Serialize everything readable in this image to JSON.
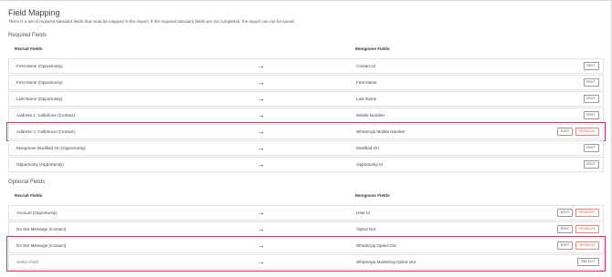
{
  "header": {
    "title": "Field Mapping",
    "description": "There is a set of required standard fields that must be mapped in the import. If the required standard fields are not completed, the import can not be saved."
  },
  "required": {
    "title": "Required Fields",
    "col_left": "Recruit Fields",
    "col_right": "Mongoose Fields",
    "rows": [
      {
        "left": "First Name (Opportunity)",
        "right": "Contact Id",
        "edit": "EDIT"
      },
      {
        "left": "First Name (Opportunity)",
        "right": "First Name",
        "edit": "EDIT"
      },
      {
        "left": "Last Name (Opportunity)",
        "right": "Last Name",
        "edit": "EDIT"
      },
      {
        "left": "Address 1: Cellphone (Contact)",
        "right": "Mobile Number",
        "edit": "EDIT"
      },
      {
        "left": "Address 1: Cellphone (Contact)",
        "right": "WhatsApp Mobile Number",
        "edit": "EDIT",
        "remove": "REMOVE"
      },
      {
        "left": "Mongoose Modified On (Opportunity)",
        "right": "Modified On",
        "edit": "EDIT"
      },
      {
        "left": "Opportunity (Opportunity)",
        "right": "Opportunity Id",
        "edit": "EDIT"
      }
    ]
  },
  "optional": {
    "title": "Optional Fields",
    "col_left": "Recruit Fields",
    "col_right": "Mongoose Fields",
    "rows": [
      {
        "left": "Account (Opportunity)",
        "right": "User Id",
        "edit": "EDIT",
        "remove": "REMOVE"
      },
      {
        "left": "Do Not Message (Contact)",
        "right": "Opted Out",
        "edit": "EDIT",
        "remove": "REMOVE"
      },
      {
        "left": "Do Not Message (Contact)",
        "right": "WhatsApp Opted Out",
        "edit": "EDIT",
        "remove": "REMOVE"
      },
      {
        "left": "Select Field",
        "right": "WhatsApp Marketing Opted Out",
        "select": "SELECT"
      }
    ]
  },
  "arrow_glyph": "→",
  "colors": {
    "highlight": "#d62a78",
    "remove": "#d6584a"
  }
}
